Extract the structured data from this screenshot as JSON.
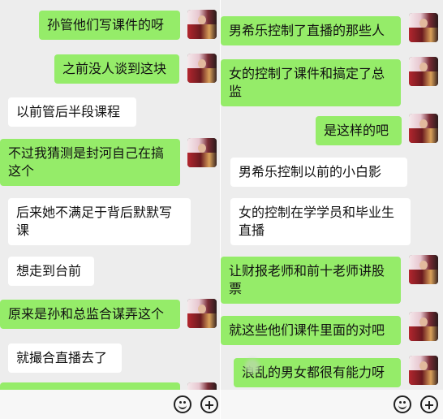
{
  "left_messages": [
    {
      "text": "孙管他们写课件的呀",
      "side": "out"
    },
    {
      "text": "之前没人谈到这块",
      "side": "out"
    },
    {
      "text": "以前管后半段课程",
      "side": "in"
    },
    {
      "text": "不过我猜测是封河自己在搞这个",
      "side": "out"
    },
    {
      "text": "后来她不满足于背后默默写课",
      "side": "in"
    },
    {
      "text": "想走到台前",
      "side": "in"
    },
    {
      "text": "原来是孙和总监合谋弄这个",
      "side": "out"
    },
    {
      "text": "就撮合直播去了",
      "side": "in"
    }
  ],
  "right_messages": [
    {
      "text": "男希乐控制了直播的那些人",
      "side": "out"
    },
    {
      "text": "女的控制了课件和搞定了总监",
      "side": "out"
    },
    {
      "text": "是这样的吧",
      "side": "out"
    },
    {
      "text": "男希乐控制以前的小白影",
      "side": "in"
    },
    {
      "text": "女的控制在学学员和毕业生直播",
      "side": "in"
    },
    {
      "text": "让财报老师和前十老师讲股票",
      "side": "out"
    },
    {
      "text": "就这些他们课件里面的对吧",
      "side": "out"
    },
    {
      "text": "浪乱的男女都很有能力呀",
      "side": "out"
    }
  ],
  "input_bar": {
    "emoji_icon": "smiley-icon",
    "add_icon": "plus-circle-icon"
  },
  "colors": {
    "outgoing_bubble": "#95ec69",
    "incoming_bubble": "#ffffff",
    "background": "#ededed"
  }
}
